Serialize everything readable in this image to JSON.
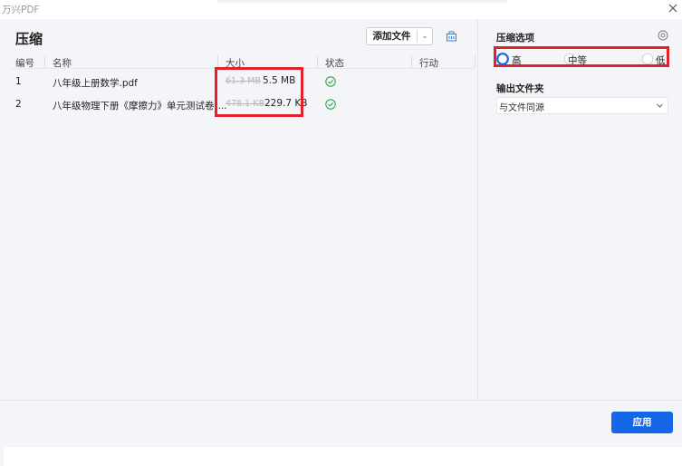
{
  "window": {
    "app_title": "万兴PDF"
  },
  "main": {
    "title": "压缩",
    "add_file_label": "添加文件",
    "columns": {
      "index": "编号",
      "name": "名称",
      "size": "大小",
      "status": "状态",
      "action": "行动"
    },
    "rows": [
      {
        "index": "1",
        "name": "八年级上册数学.pdf",
        "original_size": "61.3 MB",
        "compressed_size": "5.5 MB",
        "status": "done"
      },
      {
        "index": "2",
        "name": "八年级物理下册《摩擦力》单元测试卷(...",
        "original_size": "478.1 KB",
        "compressed_size": "229.7 KB",
        "status": "done"
      }
    ]
  },
  "options": {
    "title": "压缩选项",
    "levels": [
      {
        "label": "高",
        "selected": true
      },
      {
        "label": "中等",
        "selected": false
      },
      {
        "label": "低",
        "selected": false
      }
    ],
    "output_title": "输出文件夹",
    "output_value": "与文件同源"
  },
  "footer": {
    "apply_label": "应用"
  },
  "colors": {
    "accent": "#1667e8",
    "highlight": "#e0222a",
    "success": "#2ea84a"
  }
}
